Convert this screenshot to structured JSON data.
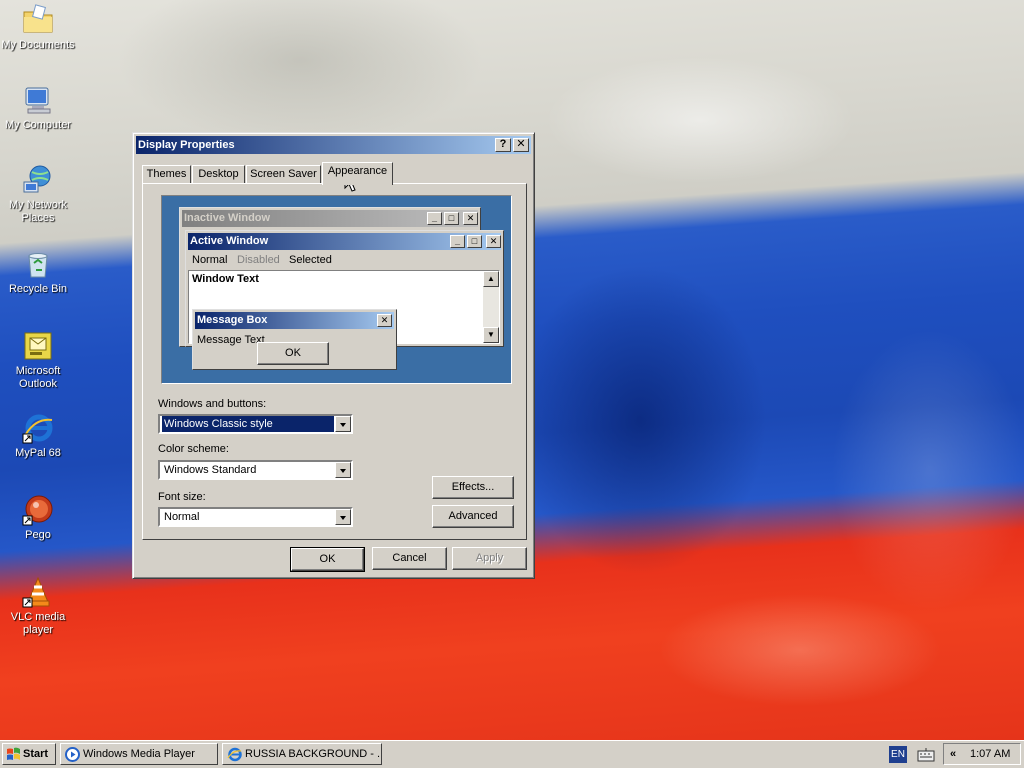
{
  "desktop": {
    "icons": [
      {
        "label": "My Documents",
        "icon": "folder-icon"
      },
      {
        "label": "My Computer",
        "icon": "computer-icon"
      },
      {
        "label": "My Network Places",
        "icon": "network-icon"
      },
      {
        "label": "Recycle Bin",
        "icon": "recycle-bin-icon"
      },
      {
        "label": "Microsoft Outlook",
        "icon": "outlook-icon"
      },
      {
        "label": "MyPal 68",
        "icon": "browser-icon"
      },
      {
        "label": "Pego",
        "icon": "pego-icon"
      },
      {
        "label": "VLC media player",
        "icon": "vlc-icon"
      }
    ]
  },
  "dialog": {
    "title": "Display Properties",
    "help_glyph": "?",
    "close_glyph": "✕",
    "tabs": [
      {
        "label": "Themes"
      },
      {
        "label": "Desktop"
      },
      {
        "label": "Screen Saver"
      },
      {
        "label": "Appearance",
        "active": true
      }
    ],
    "preview": {
      "inactive_title": "Inactive Window",
      "active_title": "Active Window",
      "menu": {
        "normal": "Normal",
        "disabled": "Disabled",
        "selected": "Selected"
      },
      "window_text": "Window Text",
      "message_box_title": "Message Box",
      "message_text": "Message Text",
      "ok": "OK"
    },
    "windows_buttons_label": "Windows and buttons:",
    "windows_buttons_value": "Windows Classic style",
    "color_scheme_label": "Color scheme:",
    "color_scheme_value": "Windows Standard",
    "font_size_label": "Font size:",
    "font_size_value": "Normal",
    "effects": "Effects...",
    "advanced": "Advanced",
    "ok": "OK",
    "cancel": "Cancel",
    "apply": "Apply"
  },
  "taskbar": {
    "start": "Start",
    "tasks": [
      {
        "label": "Windows Media Player",
        "icon": "media-player-icon"
      },
      {
        "label": "RUSSIA BACKGROUND - ...",
        "icon": "browser-icon"
      }
    ],
    "language": "EN",
    "chevron": "«",
    "clock": "1:07 AM"
  },
  "colors": {
    "active_title_start": "#0a246a",
    "active_title_end": "#a6caf0",
    "inactive_title_start": "#808080",
    "inactive_title_end": "#c0c0c0",
    "desktop_preview": "#3a6ea5",
    "face": "#d4d0c8"
  }
}
